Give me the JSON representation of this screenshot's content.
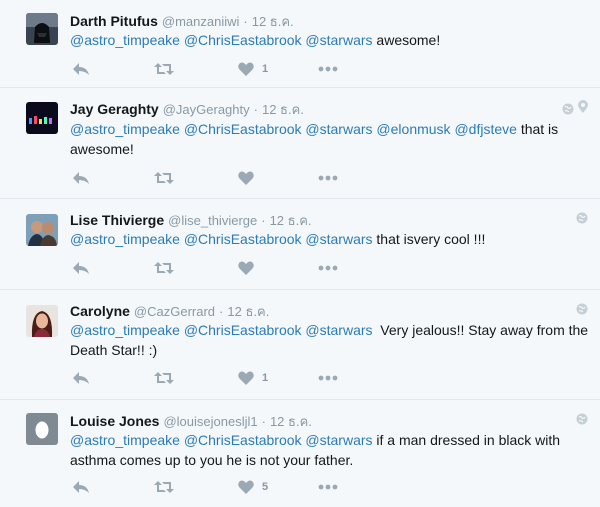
{
  "colors": {
    "mention": "#2b7bb9",
    "muted": "#8899a6",
    "icon": "#9aa9b4",
    "background": "#f5f8fa"
  },
  "tweets": [
    {
      "name": "Darth Pitufus",
      "handle": "@manzaniiwi",
      "time": "12 ธ.ค.",
      "mentions": [
        "@astro_timpeake",
        "@ChrisEastabrook",
        "@starwars"
      ],
      "text": "awesome!",
      "likes": "1",
      "avatar_icon": "darth-vader-avatar",
      "corner_icons": []
    },
    {
      "name": "Jay Geraghty",
      "handle": "@JayGeraghty",
      "time": "12 ธ.ค.",
      "mentions": [
        "@astro_timpeake",
        "@ChrisEastabrook",
        "@starwars",
        "@elonmusk",
        "@dfjsteve"
      ],
      "text": "that is awesome!",
      "likes": "",
      "avatar_icon": "night-lights-avatar",
      "corner_icons": [
        "globe-icon",
        "location-pin-icon"
      ]
    },
    {
      "name": "Lise Thivierge",
      "handle": "@lise_thivierge",
      "time": "12 ธ.ค.",
      "mentions": [
        "@astro_timpeake",
        "@ChrisEastabrook",
        "@starwars"
      ],
      "text": "that isvery cool !!!",
      "likes": "",
      "avatar_icon": "couple-photo-avatar",
      "corner_icons": [
        "globe-icon"
      ]
    },
    {
      "name": "Carolyne",
      "handle": "@CazGerrard",
      "time": "12 ธ.ค.",
      "mentions": [
        "@astro_timpeake",
        "@ChrisEastabrook",
        "@starwars"
      ],
      "text": " Very jealous!! Stay away from the Death Star!! :)",
      "likes": "1",
      "avatar_icon": "woman-photo-avatar",
      "corner_icons": [
        "globe-icon"
      ]
    },
    {
      "name": "Louise Jones",
      "handle": "@louisejonesljl1",
      "time": "12 ธ.ค.",
      "mentions": [
        "@astro_timpeake",
        "@ChrisEastabrook",
        "@starwars"
      ],
      "text": "if a man dressed in black with asthma comes up to you he is not your father.",
      "likes": "5",
      "avatar_icon": "default-egg-avatar",
      "corner_icons": [
        "globe-icon"
      ]
    }
  ]
}
